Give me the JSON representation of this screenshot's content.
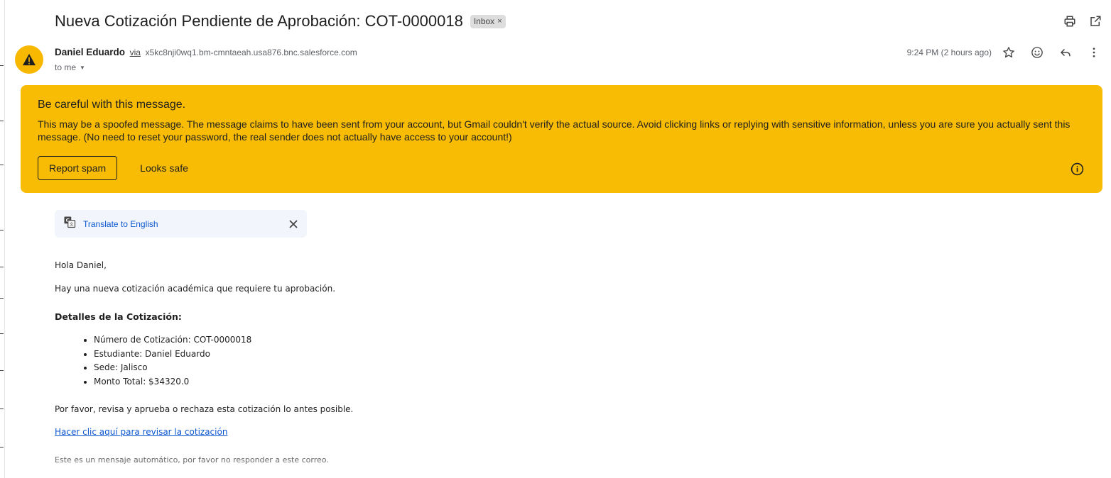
{
  "email": {
    "subject": "Nueva Cotización Pendiente de Aprobación: COT-0000018",
    "label": "Inbox",
    "label_remove": "×",
    "sender_name": "Daniel Eduardo",
    "via": "via",
    "sender_address": "x5kc8nji0wq1.bm-cmntaeah.usa876.bnc.salesforce.com",
    "to": "to me",
    "timestamp": "9:24 PM (2 hours ago)"
  },
  "warning": {
    "title": "Be careful with this message.",
    "text": "This may be a spoofed message. The message claims to have been sent from your account, but Gmail couldn't verify the actual source. Avoid clicking links or replying with sensitive information, unless you are sure you actually sent this message. (No need to reset your password, the real sender does not actually have access to your account!)",
    "report_spam": "Report spam",
    "looks_safe": "Looks safe",
    "color": "#f9bc05"
  },
  "translate": {
    "label": "Translate to English"
  },
  "body": {
    "greeting": "Hola Daniel,",
    "intro": "Hay una nueva cotización académica que requiere tu aprobación.",
    "details_heading": "Detalles de la Cotización:",
    "details": [
      "Número de Cotización: COT-0000018",
      "Estudiante: Daniel Eduardo",
      "Sede: Jalisco",
      "Monto Total: $34320.0"
    ],
    "request": "Por favor, revisa y aprueba o rechaza esta cotización lo antes posible.",
    "link": "Hacer clic aquí para revisar la cotización",
    "footer": "Este es un mensaje automático, por favor no responder a este correo."
  },
  "icons": {
    "print": "printer-icon",
    "popout": "open-in-new-window-icon",
    "star": "star-icon",
    "emoji": "emoji-reaction-icon",
    "reply": "reply-icon",
    "more": "more-vertical-icon",
    "avatar": "warning-triangle-icon",
    "info": "info-icon",
    "translate": "translate-icon",
    "close": "close-icon"
  }
}
